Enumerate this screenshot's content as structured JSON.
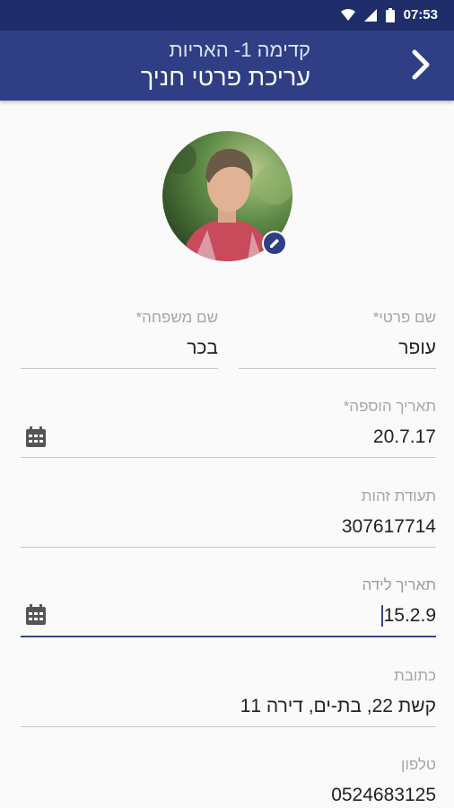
{
  "status_bar": {
    "time": "07:53"
  },
  "header": {
    "subtitle": "קדימה 1- האריות",
    "title": "עריכת פרטי חניך"
  },
  "form": {
    "first_name": {
      "label": "שם פרטי*",
      "value": "עופר"
    },
    "last_name": {
      "label": "שם משפחה*",
      "value": "בכר"
    },
    "add_date": {
      "label": "תאריך הוספה*",
      "value": "20.7.17"
    },
    "id_number": {
      "label": "תעודת זהות",
      "value": "307617714"
    },
    "birth_date": {
      "label": "תאריך לידה",
      "value": "15.2.9"
    },
    "address": {
      "label": "כתובת",
      "value": "קשת 22, בת-ים, דירה 11"
    },
    "phone": {
      "label": "טלפון",
      "value": "0524683125"
    }
  },
  "colors": {
    "primary": "#2f3e85",
    "status_bar": "#1f2d6a",
    "accent_line": "#3b4683"
  },
  "icons": {
    "back": "chevron-right-icon",
    "calendar": "calendar-icon",
    "edit": "pencil-icon"
  }
}
